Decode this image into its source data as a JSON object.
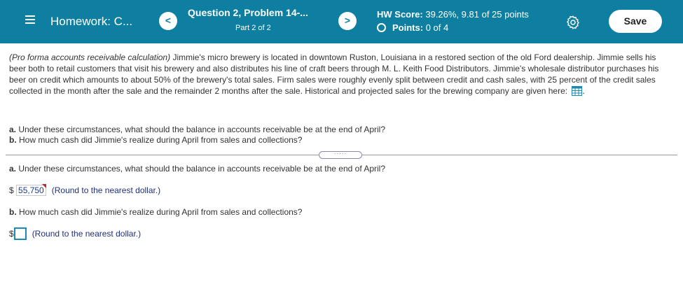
{
  "header": {
    "hw_title": "Homework: C...",
    "question_title": "Question 2, Problem 14-...",
    "question_part": "Part 2 of 2",
    "prev_label": "<",
    "next_label": ">",
    "score_label": "HW Score:",
    "score_value": "39.26%, 9.81 of 25 points",
    "points_label": "Points:",
    "points_value": "0 of 4",
    "save_label": "Save",
    "icons": [
      "menu-icon",
      "gear-icon",
      "circle-icon"
    ]
  },
  "question": {
    "intro_em": "(Pro forma accounts receivable calculation)",
    "body": " Jimmie's micro brewery is located in downtown Ruston, Louisiana in a restored section of the old Ford dealership. Jimmie sells his beer both to retail customers that visit his brewery and also distributes his line of craft beers through M. L. Keith Food Distributors. Jimmie's wholesale distributor purchases his beer on credit which amounts to about 50% of the brewery's total sales. Firm sales were roughly evenly split between credit and cash sales, with 25 percent of the credit sales collected in the month after the sale and the remainder 2 months after the sale. Historical and projected sales for the brewing company are given here:",
    "after_icon": ".",
    "part_a_label": "a.",
    "part_a_text": "Under these circumstances, what should the balance in accounts receivable be at the end of April?",
    "part_b_label": "b.",
    "part_b_text": "How much cash did Jimmie's realize during April from sales and collections?"
  },
  "expand_label": "·····",
  "answers": {
    "a_label": "a.",
    "a_question": "Under these circumstances, what should the balance in accounts receivable be at the end of April?",
    "a_currency": "$",
    "a_value": "55,750",
    "a_hint": "(Round to the nearest dollar.)",
    "b_label": "b.",
    "b_question": "How much cash did Jimmie's realize during April from sales and collections?",
    "b_currency": "$",
    "b_value": "",
    "b_hint": "(Round to the nearest dollar.)"
  },
  "colors": {
    "header_bg": "#0e7fa0",
    "input_border": "#1d8bb0",
    "flag_red": "#c0262d",
    "hint_blue": "#1f2f80"
  }
}
